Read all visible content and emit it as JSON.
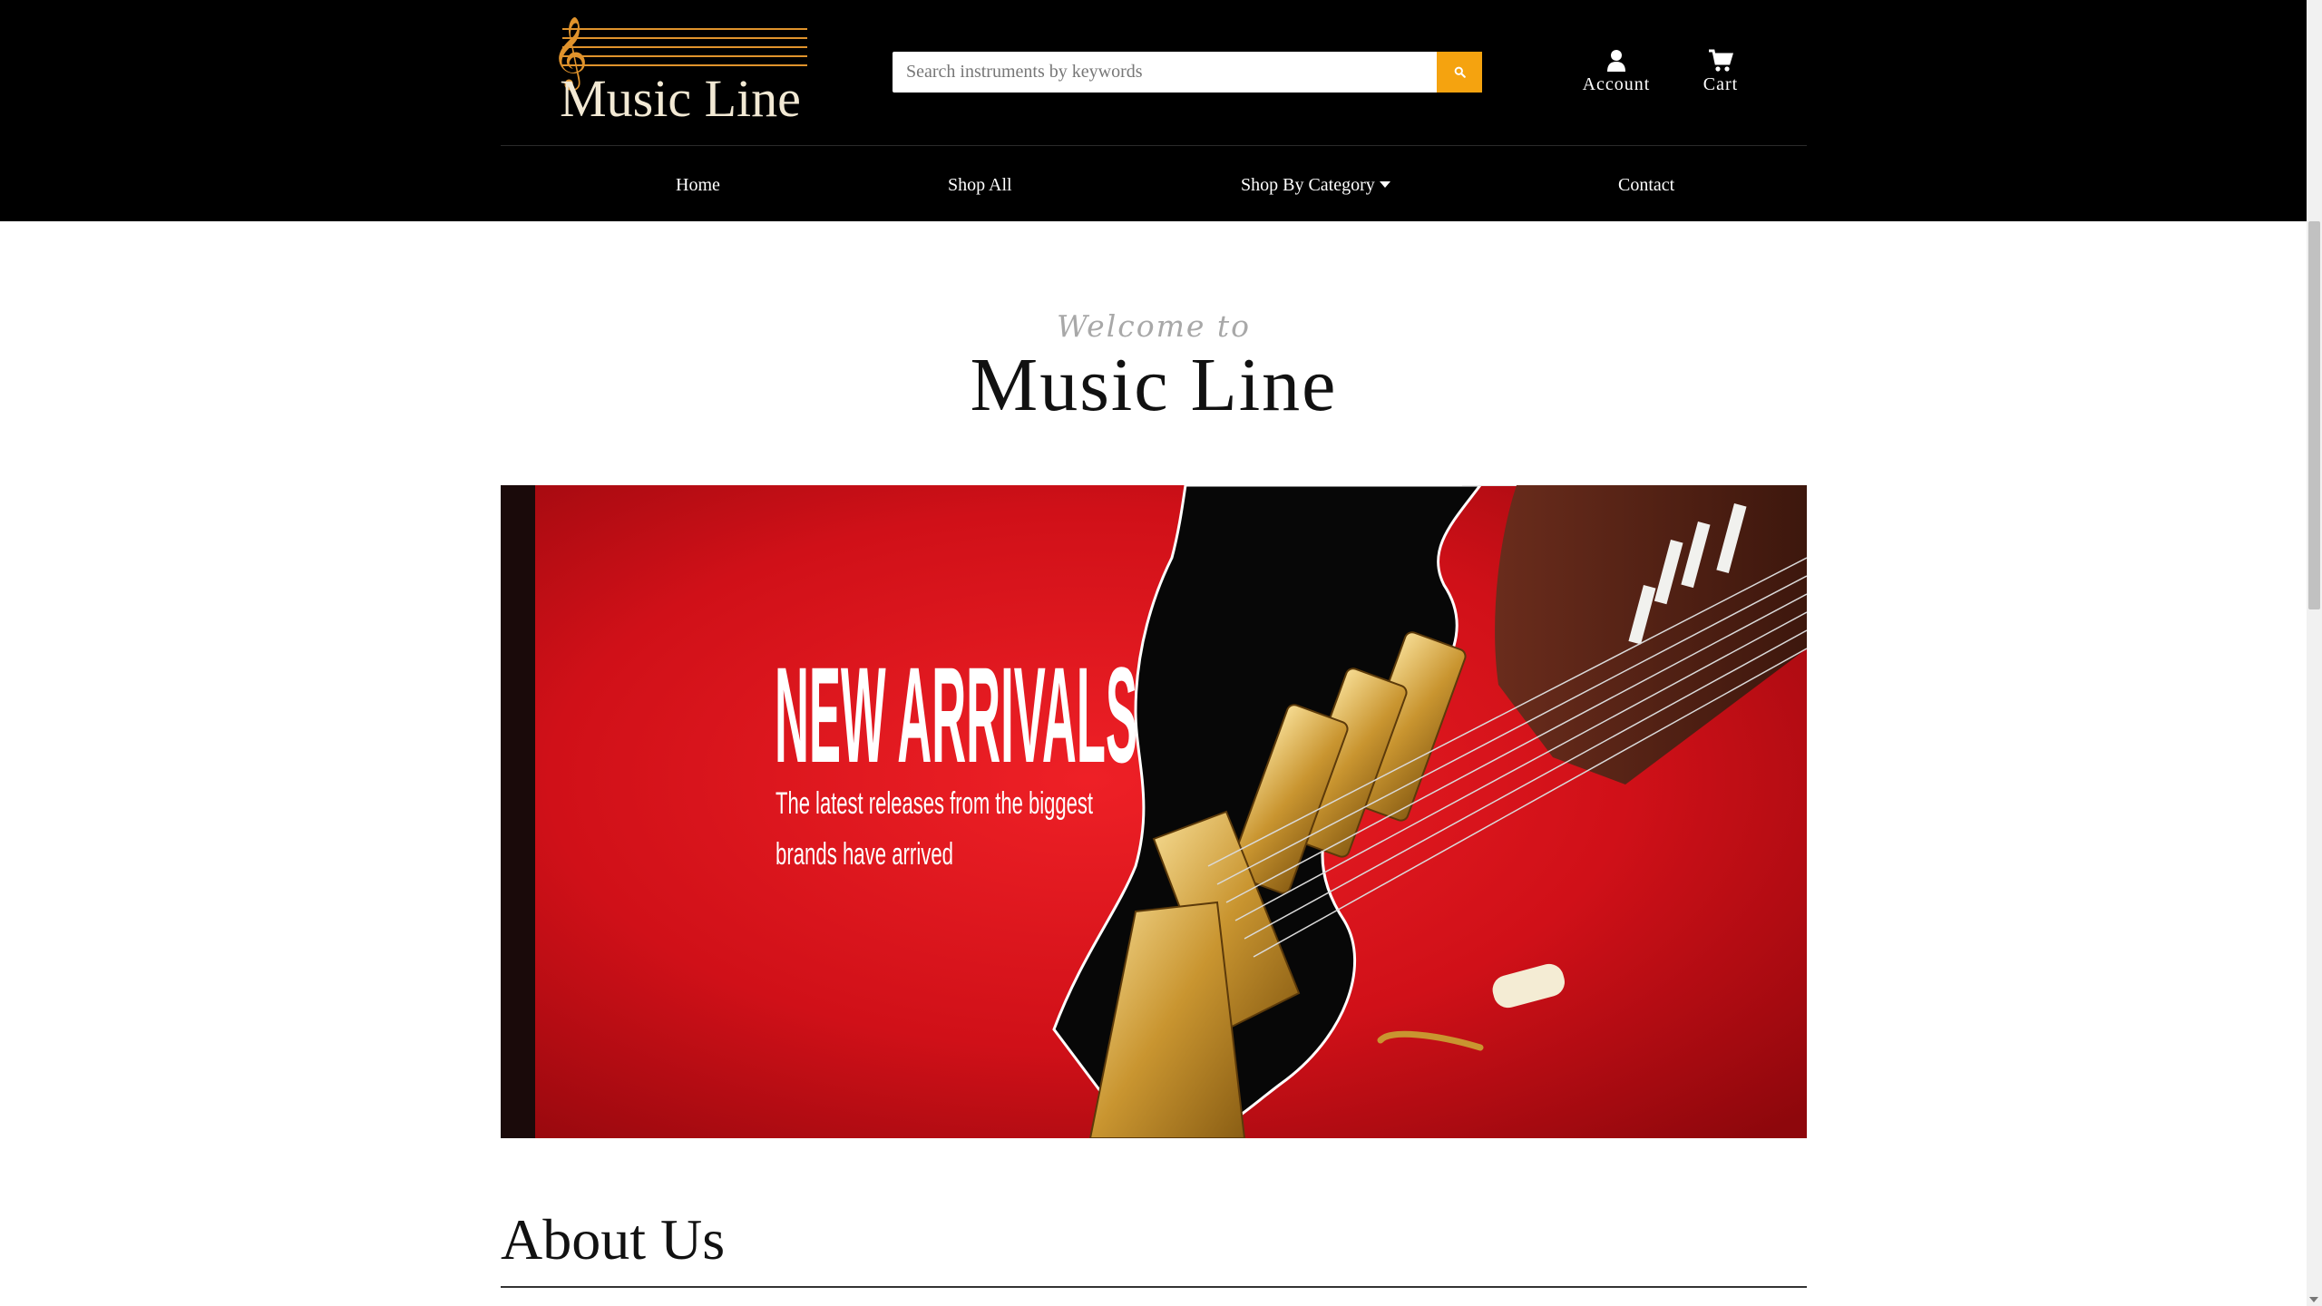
{
  "header": {
    "logo_text": "Music Line",
    "search_placeholder": "Search instruments by keywords",
    "account_label": "Account",
    "cart_label": "Cart"
  },
  "nav": {
    "items": [
      {
        "label": "Home"
      },
      {
        "label": "Shop All"
      },
      {
        "label": "Shop By Category"
      },
      {
        "label": "Contact"
      }
    ]
  },
  "welcome": {
    "subtitle": "Welcome to",
    "title": "Music Line"
  },
  "banner": {
    "headline": "NEW ARRIVALS",
    "line1": "The latest releases from the biggest",
    "line2": "brands have arrived"
  },
  "about": {
    "heading": "About Us"
  },
  "colors": {
    "header_bg": "#000000",
    "accent": "#f5a30f",
    "banner_red": "#d8121b"
  }
}
